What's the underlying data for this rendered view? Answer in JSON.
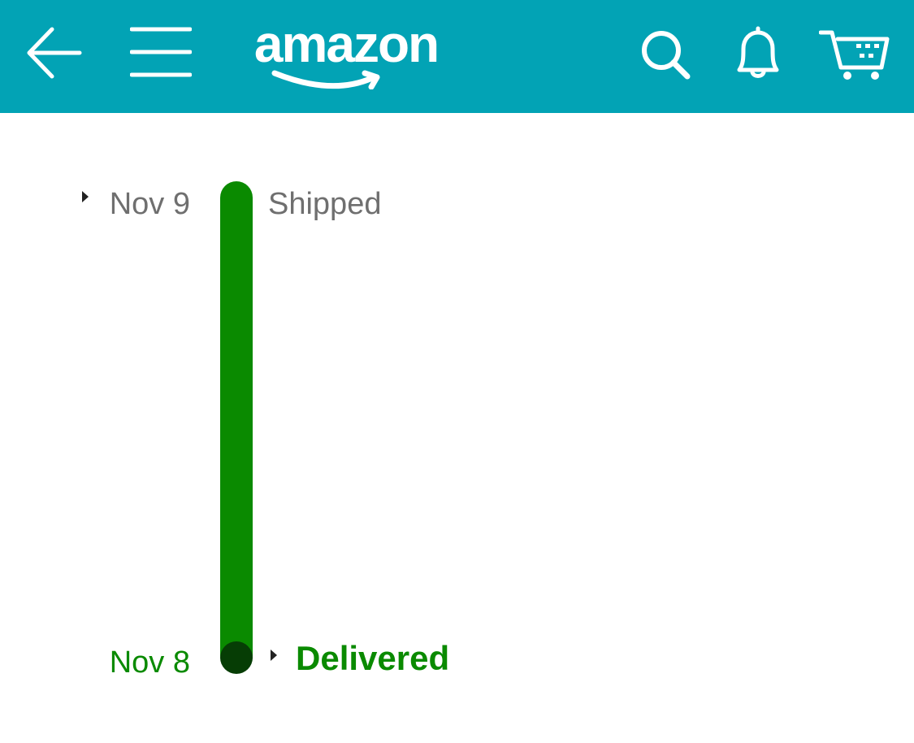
{
  "header": {
    "brand": "amazon",
    "background": "#02a3b5",
    "icons": [
      "back-arrow-icon",
      "hamburger-menu-icon",
      "search-icon",
      "bell-icon",
      "cart-icon"
    ]
  },
  "timeline": {
    "steps": [
      {
        "date": "Nov 9",
        "status": "Shipped",
        "state": "past"
      },
      {
        "date": "Nov 8",
        "status": "Delivered",
        "state": "current"
      }
    ],
    "progress_color": "#0a8a00",
    "current_dot_color": "#063d05",
    "muted_text_color": "#6f6f6f"
  }
}
